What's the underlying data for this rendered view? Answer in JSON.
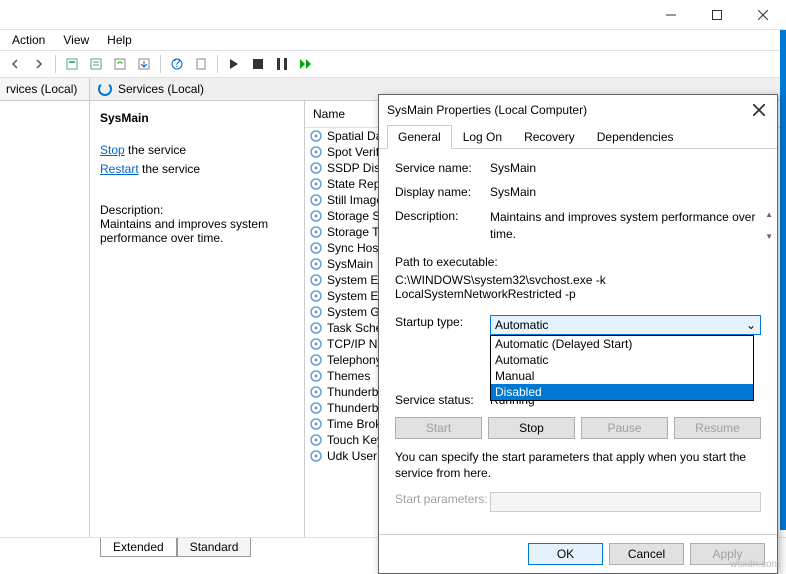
{
  "menu": {
    "action": "Action",
    "view": "View",
    "help": "Help"
  },
  "left_pane_title": "rvices (Local)",
  "right_header": "Services (Local)",
  "detail": {
    "title": "SysMain",
    "stop": "Stop",
    "stop_suffix": " the service",
    "restart": "Restart",
    "restart_suffix": " the service",
    "desc_label": "Description:",
    "desc_text": "Maintains and improves system performance over time."
  },
  "list_header": "Name",
  "services": [
    "Spatial Dat",
    "Spot Verific",
    "SSDP Disco",
    "State Repo",
    "Still Image",
    "Storage Se",
    "Storage Tie",
    "Sync Host_",
    "SysMain",
    "System Eve",
    "System Eve",
    "System Gu",
    "Task Sched",
    "TCP/IP Net",
    "Telephony",
    "Themes",
    "Thunderbo",
    "Thunderbo",
    "Time Broke",
    "Touch Keyb",
    "Udk User S"
  ],
  "tabs_bottom": {
    "extended": "Extended",
    "standard": "Standard"
  },
  "dialog": {
    "title": "SysMain Properties (Local Computer)",
    "tabs": {
      "general": "General",
      "logon": "Log On",
      "recovery": "Recovery",
      "deps": "Dependencies"
    },
    "service_name_label": "Service name:",
    "service_name": "SysMain",
    "display_name_label": "Display name:",
    "display_name": "SysMain",
    "desc_label": "Description:",
    "desc_value": "Maintains and improves system performance over time.",
    "path_label": "Path to executable:",
    "path_value": "C:\\WINDOWS\\system32\\svchost.exe -k LocalSystemNetworkRestricted -p",
    "startup_label": "Startup type:",
    "startup_selected": "Automatic",
    "startup_options": [
      "Automatic (Delayed Start)",
      "Automatic",
      "Manual",
      "Disabled"
    ],
    "status_label": "Service status:",
    "status_value": "Running",
    "btn_start": "Start",
    "btn_stop": "Stop",
    "btn_pause": "Pause",
    "btn_resume": "Resume",
    "params_hint": "You can specify the start parameters that apply when you start the service from here.",
    "params_label": "Start parameters:",
    "ok": "OK",
    "cancel": "Cancel",
    "apply": "Apply"
  },
  "watermark": "wsxdn.com"
}
